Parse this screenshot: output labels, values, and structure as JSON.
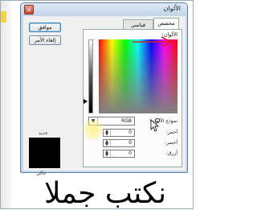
{
  "dialog": {
    "title": "الألوان",
    "close_icon": "close-icon"
  },
  "buttons": {
    "ok": "موافق",
    "cancel": "إلغاء الأمر"
  },
  "preview": {
    "new_label": "جديد",
    "current_label": "حالي",
    "new_color": "#000000",
    "current_color": "#000000"
  },
  "tabs": {
    "standard": "قياسي",
    "custom": "مخصص"
  },
  "custom": {
    "colors_label": "الألوان:",
    "model_label": "نموذج الألوان:",
    "model_value": "RGB",
    "channels": [
      {
        "label": "أحمر:",
        "value": "0"
      },
      {
        "label": "أخضر:",
        "value": "0"
      },
      {
        "label": "أزرق:",
        "value": "0"
      }
    ]
  },
  "annotation": {
    "arrow_color": "#e02020"
  },
  "background": {
    "caption": "نكتب جملا"
  }
}
